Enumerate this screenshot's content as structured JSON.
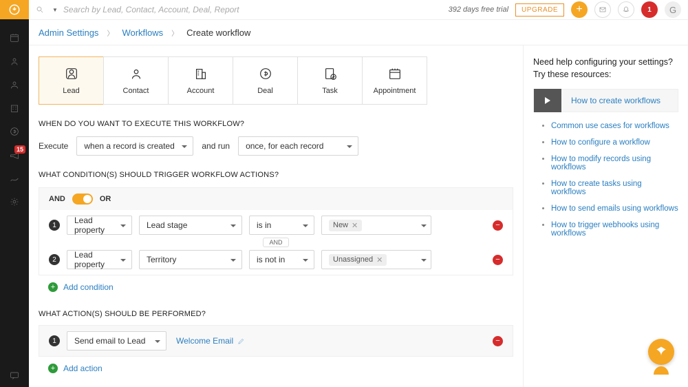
{
  "top": {
    "search_placeholder": "Search by Lead, Contact, Account, Deal, Report",
    "trial": "392 days free trial",
    "upgrade": "UPGRADE",
    "notif_count": "1",
    "avatar_initial": "G"
  },
  "rail": {
    "badge": "15"
  },
  "crumb": {
    "a": "Admin Settings",
    "b": "Workflows",
    "c": "Create workflow"
  },
  "records": {
    "lead": "Lead",
    "contact": "Contact",
    "account": "Account",
    "deal": "Deal",
    "task": "Task",
    "appointment": "Appointment"
  },
  "q1": "WHEN DO YOU WANT TO EXECUTE THIS WORKFLOW?",
  "exec": {
    "label": "Execute",
    "when": "when a record is created",
    "andrun": "and run",
    "freq": "once, for each record"
  },
  "q2": "WHAT CONDITION(S) SHOULD TRIGGER WORKFLOW ACTIONS?",
  "logic": {
    "and": "AND",
    "or": "OR",
    "sep": "AND"
  },
  "cond1": {
    "num": "1",
    "type": "Lead property",
    "field": "Lead stage",
    "op": "is in",
    "tag": "New"
  },
  "cond2": {
    "num": "2",
    "type": "Lead property",
    "field": "Territory",
    "op": "is not in",
    "tag": "Unassigned"
  },
  "add_cond": "Add condition",
  "q3": "WHAT ACTION(S) SHOULD BE PERFORMED?",
  "action1": {
    "num": "1",
    "type": "Send email to Lead",
    "name": "Welcome Email"
  },
  "add_action": "Add action",
  "help": {
    "title": "Need help configuring your settings? Try these resources:",
    "video": "How to create workflows",
    "links": [
      "Common use cases for workflows",
      "How to configure a workflow",
      "How to modify records using workflows",
      "How to create tasks using workflows",
      "How to send emails using workflows",
      "How to trigger webhooks using workflows"
    ]
  }
}
